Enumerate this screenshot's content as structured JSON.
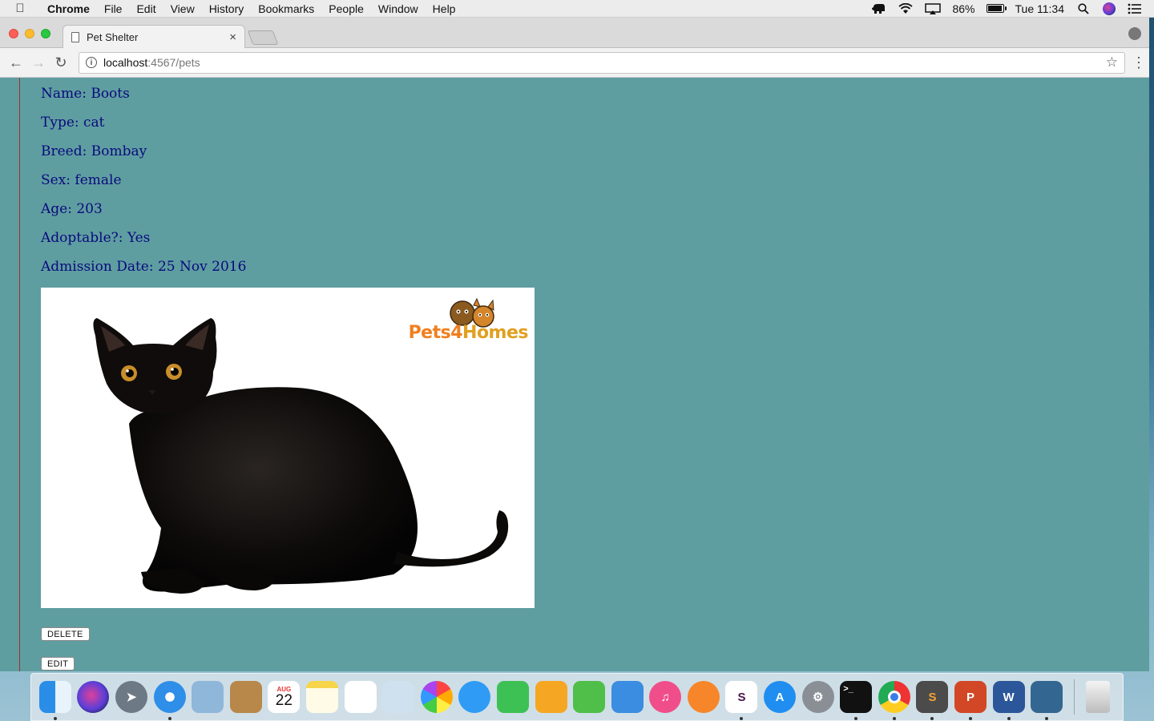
{
  "menubar": {
    "app_name": "Chrome",
    "items": [
      "File",
      "Edit",
      "View",
      "History",
      "Bookmarks",
      "People",
      "Window",
      "Help"
    ],
    "battery_percent": "86%",
    "clock": "Tue 11:34",
    "battery_level": 0.86
  },
  "browser": {
    "tab_title": "Pet Shelter",
    "url_host": "localhost",
    "url_rest": ":4567/pets",
    "close_glyph": "×",
    "back_glyph": "←",
    "forward_glyph": "→",
    "reload_glyph": "↻",
    "star_glyph": "☆",
    "menu_glyph": "⋮",
    "info_glyph": "i"
  },
  "pet": {
    "name_line": "Name: Boots",
    "type_line": "Type: cat",
    "breed_line": "Breed: Bombay",
    "sex_line": "Sex: female",
    "age_line": "Age: 203",
    "adoptable_line": "Adoptable?: Yes",
    "admission_line": "Admission Date: 25 Nov 2016",
    "photo_logo_part1": "Pets4",
    "photo_logo_part2": "Homes"
  },
  "actions": {
    "delete_label": "DELETE",
    "edit_label": "EDIT"
  },
  "colors": {
    "page_background": "#5f9ea0",
    "text_color": "#0a0a7e"
  },
  "dock": {
    "calendar_month": "AUG",
    "calendar_day": "22",
    "apps": [
      "finder-icon",
      "siri-icon",
      "launchpad-icon",
      "safari-icon",
      "mail-icon",
      "contacts-icon",
      "calendar-icon",
      "notes-icon",
      "reminders-icon",
      "preview-icon",
      "photos-icon",
      "messages-icon",
      "facetime-icon",
      "pages-icon",
      "numbers-icon",
      "keynote-icon",
      "itunes-icon",
      "ibooks-icon",
      "slack-icon",
      "app-store-icon",
      "system-preferences-icon",
      "terminal-icon",
      "chrome-icon",
      "sublime-text-icon",
      "powerpoint-icon",
      "word-icon",
      "postgres-icon",
      "trash-icon"
    ]
  }
}
